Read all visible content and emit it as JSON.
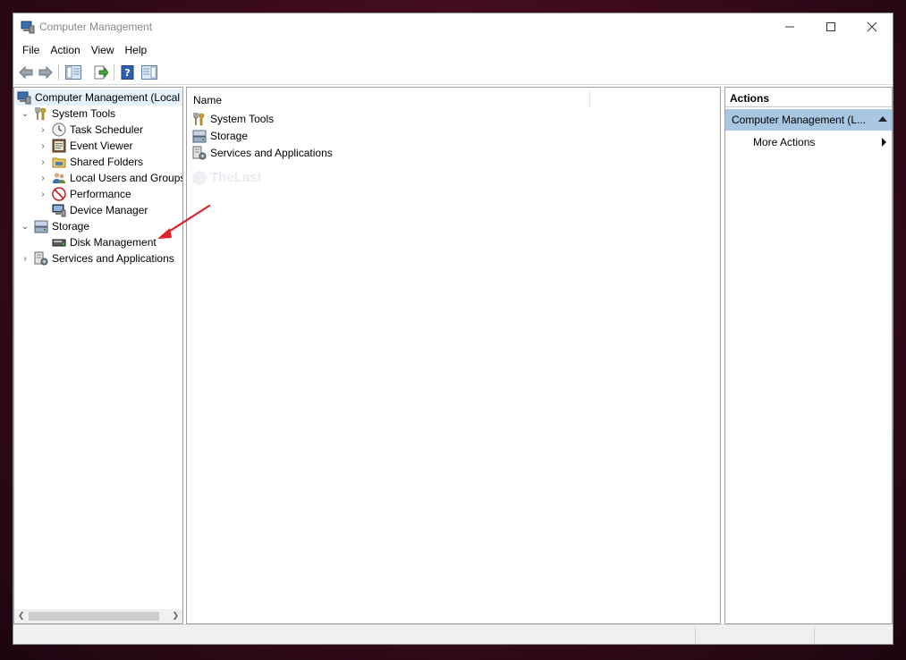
{
  "window": {
    "title": "Computer Management"
  },
  "menu": [
    "File",
    "Action",
    "View",
    "Help"
  ],
  "tree": {
    "root": "Computer Management (Local",
    "items": [
      {
        "label": "System Tools",
        "level": 1,
        "expander": "expanded",
        "icon": "tools-icon"
      },
      {
        "label": "Task Scheduler",
        "level": 2,
        "expander": "collapsed",
        "icon": "clock-icon"
      },
      {
        "label": "Event Viewer",
        "level": 2,
        "expander": "collapsed",
        "icon": "event-viewer-icon"
      },
      {
        "label": "Shared Folders",
        "level": 2,
        "expander": "collapsed",
        "icon": "shared-folder-icon"
      },
      {
        "label": "Local Users and Groups",
        "level": 2,
        "expander": "collapsed",
        "icon": "users-icon"
      },
      {
        "label": "Performance",
        "level": 2,
        "expander": "collapsed",
        "icon": "performance-icon"
      },
      {
        "label": "Device Manager",
        "level": 2,
        "expander": "none",
        "icon": "device-manager-icon"
      },
      {
        "label": "Storage",
        "level": 1,
        "expander": "expanded",
        "icon": "storage-icon"
      },
      {
        "label": "Disk Management",
        "level": 2,
        "expander": "none",
        "icon": "disk-icon"
      },
      {
        "label": "Services and Applications",
        "level": 1,
        "expander": "collapsed",
        "icon": "services-icon"
      }
    ]
  },
  "center": {
    "column_name": "Name",
    "rows": [
      {
        "label": "System Tools",
        "icon": "tools-icon"
      },
      {
        "label": "Storage",
        "icon": "storage-icon"
      },
      {
        "label": "Services and Applications",
        "icon": "services-icon"
      }
    ],
    "watermark": "TheLast"
  },
  "actions": {
    "header": "Actions",
    "group": "Computer Management (L...",
    "item": "More Actions"
  },
  "colors": {
    "selection": "#a9c6e3",
    "arrow": "#e0202a"
  }
}
